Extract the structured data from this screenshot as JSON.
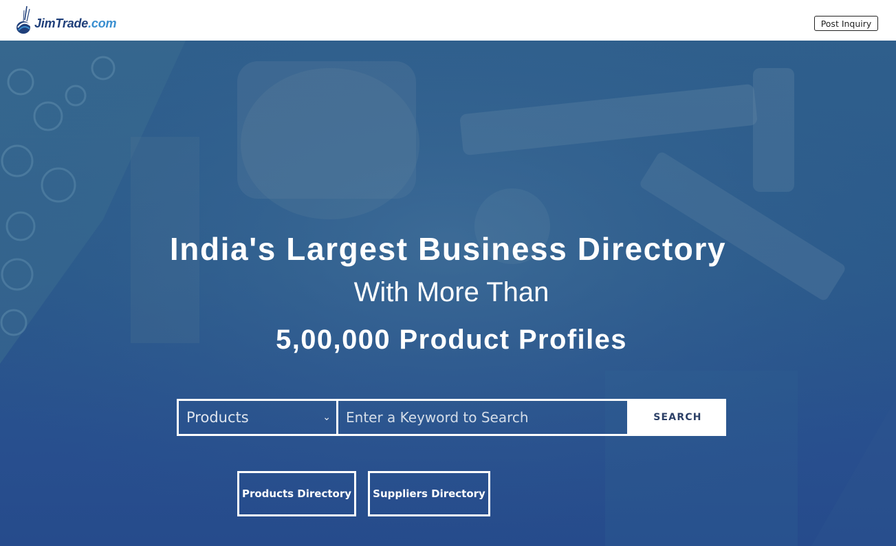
{
  "header": {
    "logo": {
      "brand": "JimTrade",
      "tld": ".com"
    },
    "post_inquiry_label": "Post Inquiry"
  },
  "hero": {
    "headline": "India's Largest Business Directory",
    "subline": "With More Than",
    "count_line": "5,00,000 Product Profiles"
  },
  "search": {
    "category_selected": "Products",
    "keyword_placeholder": "Enter a Keyword to Search",
    "button_label": "SEARCH"
  },
  "directories": [
    {
      "label": "Products Directory"
    },
    {
      "label": "Suppliers Directory"
    }
  ],
  "colors": {
    "hero_overlay": "#2b5a8b",
    "logo_dark": "#1f3f7a",
    "logo_light": "#3a8fd0",
    "search_text": "#2b3f66"
  }
}
